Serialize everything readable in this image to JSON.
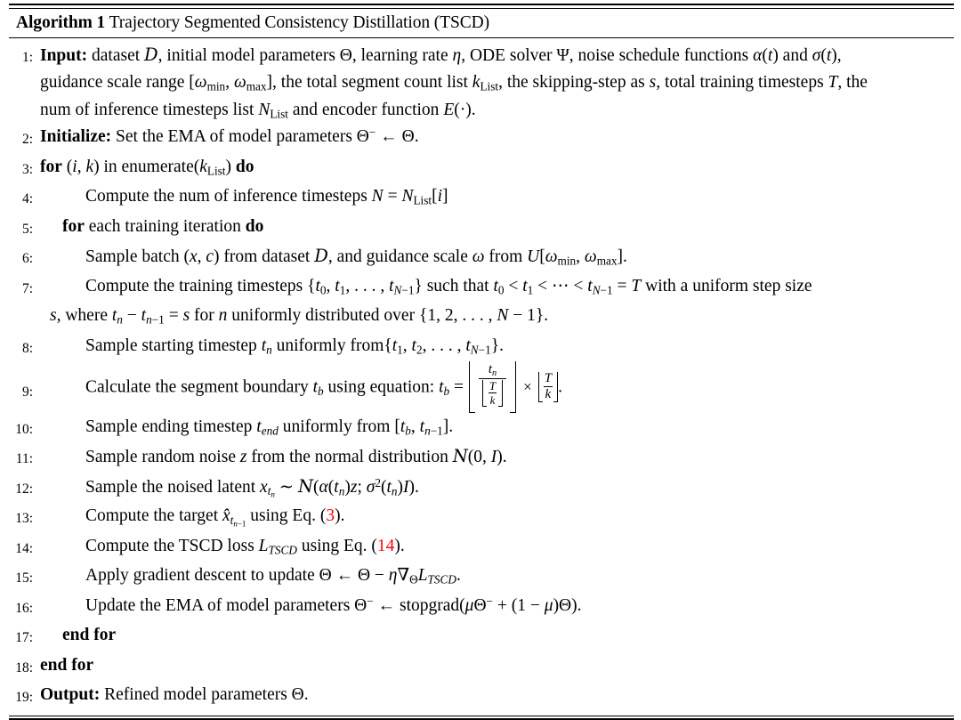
{
  "caption": {
    "label": "Algorithm 1",
    "title": "Trajectory Segmented Consistency Distillation (TSCD)"
  },
  "colors": {
    "text": "#000000",
    "background": "#ffffff",
    "eq_reference": "#FF0000",
    "rule": "#000000"
  },
  "steps": [
    {
      "number": "1:",
      "indent": 0,
      "keyword": "Input:",
      "text": "dataset D, initial model parameters Θ, learning rate η, ODE solver Ψ, noise schedule functions α(t) and σ(t), guidance scale range [ω_min, ω_max], the total segment count list k_List, the skipping-step as s, total training timesteps T, the num of inference timesteps list N_List and encoder function E(·)."
    },
    {
      "number": "2:",
      "indent": 0,
      "keyword": "Initialize:",
      "text": "Set the EMA of model parameters Θ⁻ ← Θ."
    },
    {
      "number": "3:",
      "indent": 0,
      "keyword": "for",
      "text": "(i, k) in enumerate(k_List) do"
    },
    {
      "number": "4:",
      "indent": 2,
      "keyword": "",
      "text": "Compute the num of inference timesteps N = N_List[i]"
    },
    {
      "number": "5:",
      "indent": 1,
      "keyword": "for",
      "text": "each training iteration do"
    },
    {
      "number": "6:",
      "indent": 2,
      "keyword": "",
      "text": "Sample batch (x, c) from dataset D, and guidance scale ω from U[ω_min, ω_max]."
    },
    {
      "number": "7:",
      "indent": 2,
      "keyword": "",
      "text": "Compute the training timesteps {t_0, t_1, …, t_{N−1}} such that t_0 < t_1 < ⋯ < t_{N−1} = T with a uniform step size",
      "continuation": "s, where t_n − t_{n−1} = s for n uniformly distributed over {1, 2, …, N − 1}."
    },
    {
      "number": "8:",
      "indent": 2,
      "keyword": "",
      "text": "Sample starting timestep t_n uniformly from{t_1, t_2, …, t_{N−1}}."
    },
    {
      "number": "9:",
      "indent": 2,
      "keyword": "",
      "text": "Calculate the segment boundary t_b using equation: t_b = ⌊ t_n / ⌊T/k⌋ ⌋ × ⌊T/k⌋.",
      "equation": {
        "lhs": "t_b =",
        "numerator": "t_n",
        "denominator": "T / k",
        "multiplier": "T / k",
        "times_symbol": "×",
        "trailing": "."
      }
    },
    {
      "number": "10:",
      "indent": 2,
      "keyword": "",
      "text": "Sample ending timestep t_end uniformly from [t_b, t_{n−1}]."
    },
    {
      "number": "11:",
      "indent": 2,
      "keyword": "",
      "text": "Sample random noise z from the normal distribution N(0, I)."
    },
    {
      "number": "12:",
      "indent": 2,
      "keyword": "",
      "text": "Sample the noised latent x_{t_n} ∼ N(α(t_n)z; σ²(t_n)I)."
    },
    {
      "number": "13:",
      "indent": 2,
      "keyword": "",
      "text": "Compute the target x̂_{t_{n−1}} using Eq. (3).",
      "eq_ref": "3"
    },
    {
      "number": "14:",
      "indent": 2,
      "keyword": "",
      "text": "Compute the TSCD loss L_TSCD using Eq. (14).",
      "eq_ref": "14"
    },
    {
      "number": "15:",
      "indent": 2,
      "keyword": "",
      "text": "Apply gradient descent to update Θ ← Θ − η∇_Θ L_TSCD."
    },
    {
      "number": "16:",
      "indent": 2,
      "keyword": "",
      "text": "Update the EMA of model parameters Θ⁻ ← stopgrad(μΘ⁻ + (1 − μ)Θ)."
    },
    {
      "number": "17:",
      "indent": 1,
      "keyword": "end for",
      "text": ""
    },
    {
      "number": "18:",
      "indent": 0,
      "keyword": "end for",
      "text": ""
    },
    {
      "number": "19:",
      "indent": 0,
      "keyword": "Output:",
      "text": "Refined model parameters Θ."
    }
  ],
  "symbols": {
    "dataset": "D",
    "theta": "Θ",
    "theta_ema": "Θ⁻",
    "eta": "η",
    "psi": "Ψ",
    "alpha": "α",
    "sigma": "σ",
    "omega": "ω",
    "mu": "μ",
    "arrow_left": "←",
    "tilde": "∼",
    "nabla": "∇",
    "times": "×",
    "floor_left": "⌊",
    "floor_right": "⌋"
  }
}
